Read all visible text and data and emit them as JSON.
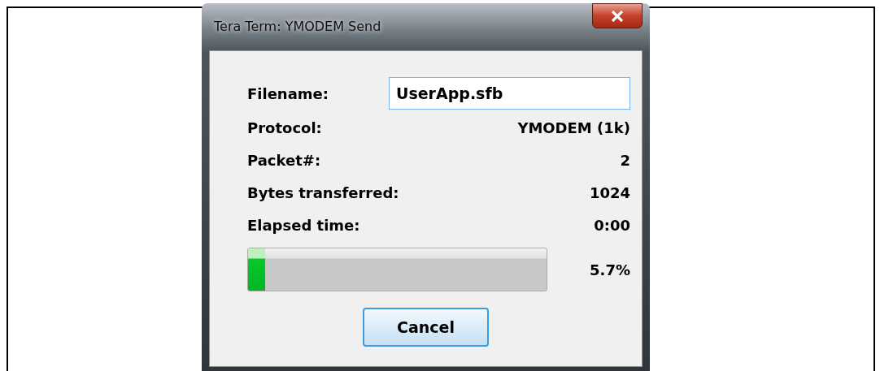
{
  "window": {
    "title": "Tera Term: YMODEM Send"
  },
  "filename": {
    "label": "Filename:",
    "value": "UserApp.sfb"
  },
  "fields": [
    {
      "label": "Protocol:",
      "value": "YMODEM (1k)"
    },
    {
      "label": "Packet#:",
      "value": "2"
    },
    {
      "label": "Bytes transferred:",
      "value": "1024"
    },
    {
      "label": "Elapsed time:",
      "value": "0:00"
    }
  ],
  "progress": {
    "level": 0.057,
    "reading": "5.7%"
  },
  "buttons": [
    "Cancel"
  ]
}
